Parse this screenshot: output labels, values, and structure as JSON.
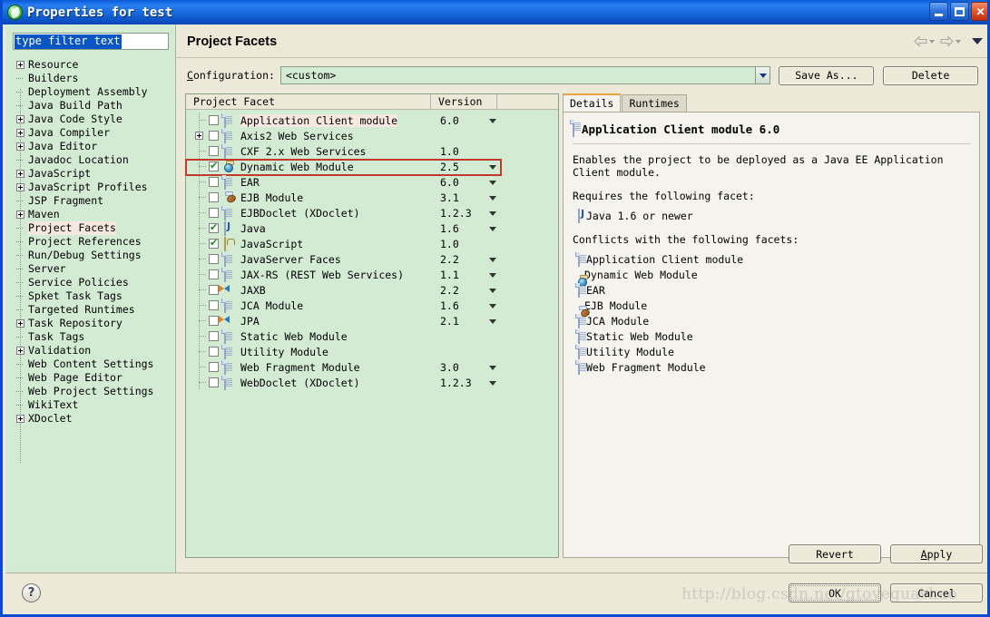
{
  "window": {
    "title": "Properties for test",
    "icon": "eclipse-leaf-icon",
    "minimize_label": "Minimize",
    "maximize_label": "Maximize",
    "close_label": "Close"
  },
  "sidebar": {
    "filter": {
      "value": "type filter text",
      "placeholder": "type filter text"
    },
    "items": [
      {
        "label": "Resource",
        "expandable": true
      },
      {
        "label": "Builders",
        "expandable": false
      },
      {
        "label": "Deployment Assembly",
        "expandable": false
      },
      {
        "label": "Java Build Path",
        "expandable": false
      },
      {
        "label": "Java Code Style",
        "expandable": true
      },
      {
        "label": "Java Compiler",
        "expandable": true
      },
      {
        "label": "Java Editor",
        "expandable": true
      },
      {
        "label": "Javadoc Location",
        "expandable": false
      },
      {
        "label": "JavaScript",
        "expandable": true
      },
      {
        "label": "JavaScript Profiles",
        "expandable": true
      },
      {
        "label": "JSP Fragment",
        "expandable": false
      },
      {
        "label": "Maven",
        "expandable": true
      },
      {
        "label": "Project Facets",
        "expandable": false,
        "selected": true
      },
      {
        "label": "Project References",
        "expandable": false
      },
      {
        "label": "Run/Debug Settings",
        "expandable": false
      },
      {
        "label": "Server",
        "expandable": false
      },
      {
        "label": "Service Policies",
        "expandable": false
      },
      {
        "label": "Spket Task Tags",
        "expandable": false
      },
      {
        "label": "Targeted Runtimes",
        "expandable": false
      },
      {
        "label": "Task Repository",
        "expandable": true
      },
      {
        "label": "Task Tags",
        "expandable": false
      },
      {
        "label": "Validation",
        "expandable": true
      },
      {
        "label": "Web Content Settings",
        "expandable": false
      },
      {
        "label": "Web Page Editor",
        "expandable": false
      },
      {
        "label": "Web Project Settings",
        "expandable": false
      },
      {
        "label": "WikiText",
        "expandable": false
      },
      {
        "label": "XDoclet",
        "expandable": true
      }
    ]
  },
  "main": {
    "page_title": "Project Facets",
    "back_label": "Back",
    "forward_label": "Forward",
    "menu_label": "View Menu",
    "configuration": {
      "label": "Configuration:",
      "value": "<custom>",
      "save_as_label": "Save As...",
      "delete_label": "Delete"
    }
  },
  "facets_table": {
    "columns": [
      "Project Facet",
      "Version",
      ""
    ],
    "rows": [
      {
        "name": "Application Client module",
        "version": "6.0",
        "checked": false,
        "expandable": false,
        "icon": "doc-icon",
        "has_version_dropdown": true,
        "name_highlighted": true
      },
      {
        "name": "Axis2 Web Services",
        "version": "",
        "checked": false,
        "expandable": true,
        "icon": "doc-icon",
        "has_version_dropdown": false
      },
      {
        "name": "CXF 2.x Web Services",
        "version": "1.0",
        "checked": false,
        "expandable": false,
        "icon": "doc-icon",
        "has_version_dropdown": false
      },
      {
        "name": "Dynamic Web Module",
        "version": "2.5",
        "checked": true,
        "expandable": false,
        "icon": "globe-icon",
        "has_version_dropdown": true,
        "red_outlined": true
      },
      {
        "name": "EAR",
        "version": "6.0",
        "checked": false,
        "expandable": false,
        "icon": "doc-icon",
        "has_version_dropdown": true
      },
      {
        "name": "EJB Module",
        "version": "3.1",
        "checked": false,
        "expandable": false,
        "icon": "ejb-icon",
        "has_version_dropdown": true
      },
      {
        "name": "EJBDoclet (XDoclet)",
        "version": "1.2.3",
        "checked": false,
        "expandable": false,
        "icon": "doc-icon",
        "has_version_dropdown": true
      },
      {
        "name": "Java",
        "version": "1.6",
        "checked": true,
        "expandable": false,
        "icon": "java-icon",
        "has_version_dropdown": true
      },
      {
        "name": "JavaScript",
        "version": "1.0",
        "checked": true,
        "expandable": false,
        "icon": "js-icon",
        "has_version_dropdown": false
      },
      {
        "name": "JavaServer Faces",
        "version": "2.2",
        "checked": false,
        "expandable": false,
        "icon": "doc-icon",
        "has_version_dropdown": true
      },
      {
        "name": "JAX-RS (REST Web Services)",
        "version": "1.1",
        "checked": false,
        "expandable": false,
        "icon": "doc-icon",
        "has_version_dropdown": true
      },
      {
        "name": "JAXB",
        "version": "2.2",
        "checked": false,
        "expandable": false,
        "icon": "arrows-icon",
        "has_version_dropdown": true
      },
      {
        "name": "JCA Module",
        "version": "1.6",
        "checked": false,
        "expandable": false,
        "icon": "doc-icon",
        "has_version_dropdown": true
      },
      {
        "name": "JPA",
        "version": "2.1",
        "checked": false,
        "expandable": false,
        "icon": "arrows-icon",
        "has_version_dropdown": true
      },
      {
        "name": "Static Web Module",
        "version": "",
        "checked": false,
        "expandable": false,
        "icon": "doc-icon",
        "has_version_dropdown": false
      },
      {
        "name": "Utility Module",
        "version": "",
        "checked": false,
        "expandable": false,
        "icon": "doc-icon",
        "has_version_dropdown": false
      },
      {
        "name": "Web Fragment Module",
        "version": "3.0",
        "checked": false,
        "expandable": false,
        "icon": "doc-icon",
        "has_version_dropdown": true
      },
      {
        "name": "WebDoclet (XDoclet)",
        "version": "1.2.3",
        "checked": false,
        "expandable": false,
        "icon": "doc-icon",
        "has_version_dropdown": true
      }
    ]
  },
  "details": {
    "tabs": [
      {
        "label": "Details",
        "active": true
      },
      {
        "label": "Runtimes",
        "active": false
      }
    ],
    "title": "Application Client module 6.0",
    "title_icon": "doc-icon",
    "description": "Enables the project to be deployed as a Java EE Application Client module.",
    "requires_heading": "Requires the following facet:",
    "requires": [
      {
        "label": "Java 1.6 or newer",
        "icon": "java-icon"
      }
    ],
    "conflicts_heading": "Conflicts with the following facets:",
    "conflicts": [
      {
        "label": "Application Client module",
        "icon": "doc-icon"
      },
      {
        "label": "Dynamic Web Module",
        "icon": "globe-icon"
      },
      {
        "label": "EAR",
        "icon": "doc-icon"
      },
      {
        "label": "EJB Module",
        "icon": "ejb-icon"
      },
      {
        "label": "JCA Module",
        "icon": "doc-icon"
      },
      {
        "label": "Static Web Module",
        "icon": "doc-icon"
      },
      {
        "label": "Utility Module",
        "icon": "doc-icon"
      },
      {
        "label": "Web Fragment Module",
        "icon": "doc-icon"
      }
    ]
  },
  "buttons": {
    "revert": "Revert",
    "apply": "Apply",
    "ok": "OK",
    "cancel": "Cancel",
    "help": "?"
  },
  "watermark": "http://blog.csdn.net/gtoveguashao",
  "colors": {
    "titlebar": "#1267e0",
    "dialog_bg": "#ece9d8",
    "tree_bg": "#d3ead3",
    "table_bg": "#d3ead3",
    "details_bg": "#f4f3ee",
    "highlight_outline": "#c0392b",
    "selection": "#0a55c4"
  }
}
